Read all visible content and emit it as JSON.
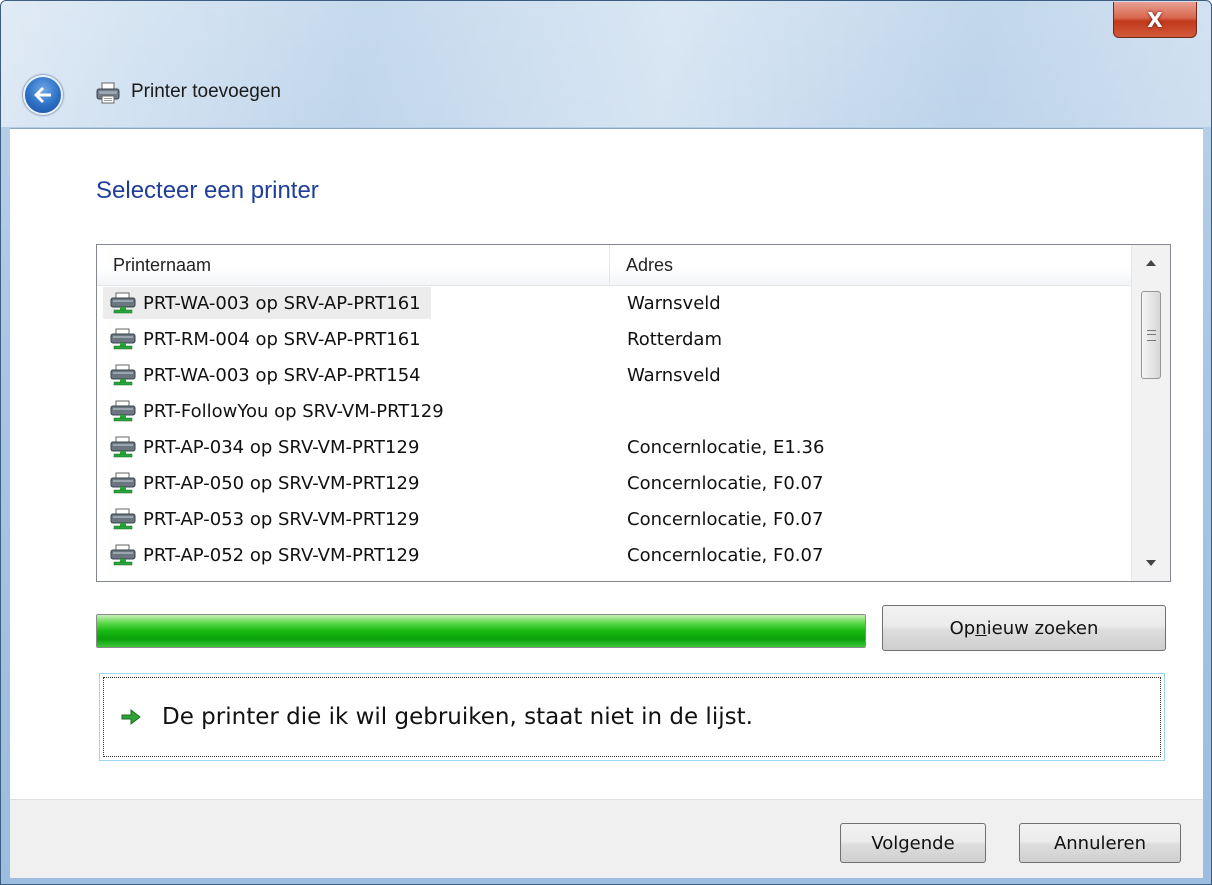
{
  "window": {
    "title": "Printer toevoegen",
    "close_glyph": "X"
  },
  "main": {
    "heading": "Selecteer een printer",
    "list": {
      "columns": [
        "Printernaam",
        "Adres"
      ],
      "rows": [
        {
          "name": "PRT-WA-003 op SRV-AP-PRT161",
          "address": "Warnsveld",
          "selected": true
        },
        {
          "name": "PRT-RM-004 op SRV-AP-PRT161",
          "address": "Rotterdam"
        },
        {
          "name": "PRT-WA-003 op SRV-AP-PRT154",
          "address": "Warnsveld"
        },
        {
          "name": "PRT-FollowYou op SRV-VM-PRT129",
          "address": ""
        },
        {
          "name": "PRT-AP-034 op SRV-VM-PRT129",
          "address": "Concernlocatie, E1.36"
        },
        {
          "name": "PRT-AP-050 op SRV-VM-PRT129",
          "address": "Concernlocatie, F0.07"
        },
        {
          "name": "PRT-AP-053 op SRV-VM-PRT129",
          "address": "Concernlocatie, F0.07"
        },
        {
          "name": "PRT-AP-052 op SRV-VM-PRT129",
          "address": "Concernlocatie, F0.07"
        }
      ]
    },
    "progress": {
      "percent": 100
    },
    "rescan_button": {
      "pre": "Op",
      "accel": "n",
      "post": "ieuw zoeken"
    },
    "not_listed_link": "De printer die ik wil gebruiken, staat niet in de lijst."
  },
  "footer": {
    "next_label": "Volgende",
    "cancel_label": "Annuleren"
  },
  "icons": {
    "back": "back-arrow-icon",
    "title": "printer-icon",
    "row": "network-printer-icon",
    "link": "green-arrow-icon"
  },
  "colors": {
    "heading": "#1e3e9a",
    "progress": "#19b913",
    "close_button": "#c1391c"
  }
}
